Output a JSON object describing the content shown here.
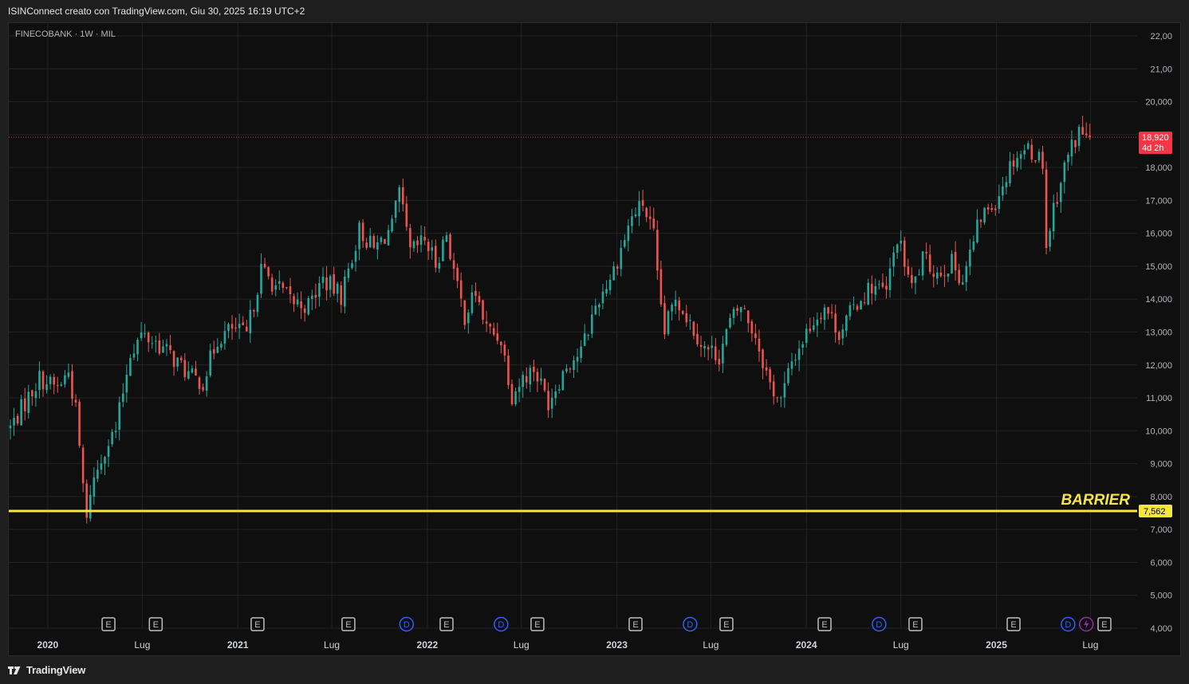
{
  "header": {
    "title": "ISINConnect creato con TradingView.com, Giu 30, 2025 16:19 UTC+2"
  },
  "symbol_label": "FINECOBANK · 1W · MIL",
  "footer": {
    "brand": "TradingView",
    "brand_icon": "tradingview-logo-icon"
  },
  "colors": {
    "background": "#0f0f0f",
    "grid": "#232323",
    "up": "#26a69a",
    "down": "#ef5350",
    "barrier": "#f5e642",
    "price_tag": "#f23645",
    "dividend": "#2962ff",
    "earnings": "#bfbfbf",
    "split": "#9c27b0"
  },
  "chart_data": {
    "type": "candlestick",
    "interval": "1W",
    "y_axis": {
      "ticks": [
        "22,00",
        "21,00",
        "20,000",
        "19,000",
        "18,000",
        "17,000",
        "16,000",
        "15,000",
        "14,000",
        "13,000",
        "12,000",
        "11,000",
        "10,000",
        "9,000",
        "8,000",
        "7,000",
        "6,000",
        "5,000",
        "4,000"
      ],
      "range": [
        4,
        22
      ],
      "position": "right"
    },
    "x_axis": {
      "labels": [
        {
          "text": "2020",
          "date": "2020-01-01",
          "bold": true
        },
        {
          "text": "Lug",
          "date": "2020-07-01",
          "bold": false
        },
        {
          "text": "2021",
          "date": "2021-01-01",
          "bold": true
        },
        {
          "text": "Lug",
          "date": "2021-07-01",
          "bold": false
        },
        {
          "text": "2022",
          "date": "2022-01-01",
          "bold": true
        },
        {
          "text": "Lug",
          "date": "2022-07-01",
          "bold": false
        },
        {
          "text": "2023",
          "date": "2023-01-01",
          "bold": true
        },
        {
          "text": "Lug",
          "date": "2023-07-01",
          "bold": false
        },
        {
          "text": "2024",
          "date": "2024-01-01",
          "bold": true
        },
        {
          "text": "Lug",
          "date": "2024-07-01",
          "bold": false
        },
        {
          "text": "2025",
          "date": "2025-01-01",
          "bold": true
        },
        {
          "text": "Lug",
          "date": "2025-07-01",
          "bold": false
        }
      ],
      "range": [
        "2019-10-21",
        "2025-09-29"
      ]
    },
    "grid": true,
    "current_price": {
      "value": 18.92,
      "label": "18,920",
      "countdown": "4d 2h"
    },
    "barrier": {
      "value": 7.562,
      "label": "7,562",
      "annotation": "BARRIER"
    },
    "events": [
      {
        "type": "E",
        "date": "2020-04-27"
      },
      {
        "type": "E",
        "date": "2020-07-27"
      },
      {
        "type": "E",
        "date": "2021-02-08"
      },
      {
        "type": "E",
        "date": "2021-08-02"
      },
      {
        "type": "D",
        "date": "2021-11-22"
      },
      {
        "type": "E",
        "date": "2022-02-07"
      },
      {
        "type": "D",
        "date": "2022-05-23"
      },
      {
        "type": "E",
        "date": "2022-08-01"
      },
      {
        "type": "E",
        "date": "2023-02-06"
      },
      {
        "type": "D",
        "date": "2023-05-22"
      },
      {
        "type": "E",
        "date": "2023-07-31"
      },
      {
        "type": "E",
        "date": "2024-02-05"
      },
      {
        "type": "D",
        "date": "2024-05-20"
      },
      {
        "type": "E",
        "date": "2024-07-29"
      },
      {
        "type": "E",
        "date": "2025-02-03"
      },
      {
        "type": "D",
        "date": "2025-05-19"
      },
      {
        "type": "S",
        "date": "2025-06-23"
      },
      {
        "type": "E",
        "date": "2025-07-28"
      }
    ],
    "path": [
      [
        "2019-10-21",
        10.1
      ],
      [
        "2019-12-16",
        11.6
      ],
      [
        "2020-01-20",
        11.3
      ],
      [
        "2020-02-10",
        11.8
      ],
      [
        "2020-02-24",
        10.6
      ],
      [
        "2020-03-16",
        7.2
      ],
      [
        "2020-03-23",
        8.2
      ],
      [
        "2020-04-20",
        9.5
      ],
      [
        "2020-05-11",
        10.0
      ],
      [
        "2020-06-08",
        12.4
      ],
      [
        "2020-06-29",
        12.9
      ],
      [
        "2020-07-27",
        12.7
      ],
      [
        "2020-08-24",
        12.3
      ],
      [
        "2020-10-05",
        11.6
      ],
      [
        "2020-10-26",
        11.5
      ],
      [
        "2020-11-23",
        12.8
      ],
      [
        "2020-12-21",
        13.1
      ],
      [
        "2021-01-18",
        12.9
      ],
      [
        "2021-02-15",
        14.9
      ],
      [
        "2021-03-15",
        14.4
      ],
      [
        "2021-04-19",
        13.9
      ],
      [
        "2021-05-17",
        13.8
      ],
      [
        "2021-06-14",
        14.6
      ],
      [
        "2021-07-19",
        14.1
      ],
      [
        "2021-08-23",
        16.1
      ],
      [
        "2021-09-20",
        15.5
      ],
      [
        "2021-10-25",
        16.2
      ],
      [
        "2021-11-08",
        17.2
      ],
      [
        "2021-11-29",
        15.4
      ],
      [
        "2021-12-27",
        15.8
      ],
      [
        "2022-01-17",
        15.1
      ],
      [
        "2022-02-07",
        16.0
      ],
      [
        "2022-02-28",
        14.3
      ],
      [
        "2022-03-14",
        13.5
      ],
      [
        "2022-04-04",
        14.2
      ],
      [
        "2022-04-25",
        13.1
      ],
      [
        "2022-05-23",
        12.8
      ],
      [
        "2022-06-13",
        11.1
      ],
      [
        "2022-07-04",
        11.6
      ],
      [
        "2022-07-25",
        11.9
      ],
      [
        "2022-08-22",
        10.9
      ],
      [
        "2022-09-26",
        12.0
      ],
      [
        "2022-10-24",
        12.4
      ],
      [
        "2022-11-21",
        13.8
      ],
      [
        "2022-12-26",
        14.9
      ],
      [
        "2023-01-30",
        16.5
      ],
      [
        "2023-02-20",
        16.9
      ],
      [
        "2023-03-13",
        15.9
      ],
      [
        "2023-03-20",
        14.6
      ],
      [
        "2023-04-03",
        13.0
      ],
      [
        "2023-04-24",
        14.1
      ],
      [
        "2023-05-22",
        13.3
      ],
      [
        "2023-06-19",
        12.5
      ],
      [
        "2023-07-17",
        12.3
      ],
      [
        "2023-08-07",
        13.3
      ],
      [
        "2023-08-28",
        13.8
      ],
      [
        "2023-09-25",
        12.9
      ],
      [
        "2023-10-23",
        11.4
      ],
      [
        "2023-11-13",
        10.9
      ],
      [
        "2023-12-04",
        12.1
      ],
      [
        "2024-01-08",
        13.2
      ],
      [
        "2024-02-05",
        13.8
      ],
      [
        "2024-03-04",
        13.0
      ],
      [
        "2024-04-08",
        13.9
      ],
      [
        "2024-05-06",
        14.4
      ],
      [
        "2024-06-03",
        14.2
      ],
      [
        "2024-06-24",
        15.9
      ],
      [
        "2024-07-22",
        14.3
      ],
      [
        "2024-08-12",
        15.2
      ],
      [
        "2024-09-09",
        14.8
      ],
      [
        "2024-10-07",
        15.1
      ],
      [
        "2024-10-28",
        14.6
      ],
      [
        "2024-12-02",
        16.5
      ],
      [
        "2024-12-30",
        17.0
      ],
      [
        "2025-02-03",
        18.3
      ],
      [
        "2025-03-03",
        18.6
      ],
      [
        "2025-03-31",
        18.2
      ],
      [
        "2025-04-07",
        15.6
      ],
      [
        "2025-04-21",
        16.8
      ],
      [
        "2025-05-19",
        18.4
      ],
      [
        "2025-06-09",
        19.1
      ],
      [
        "2025-06-30",
        18.92
      ]
    ]
  }
}
